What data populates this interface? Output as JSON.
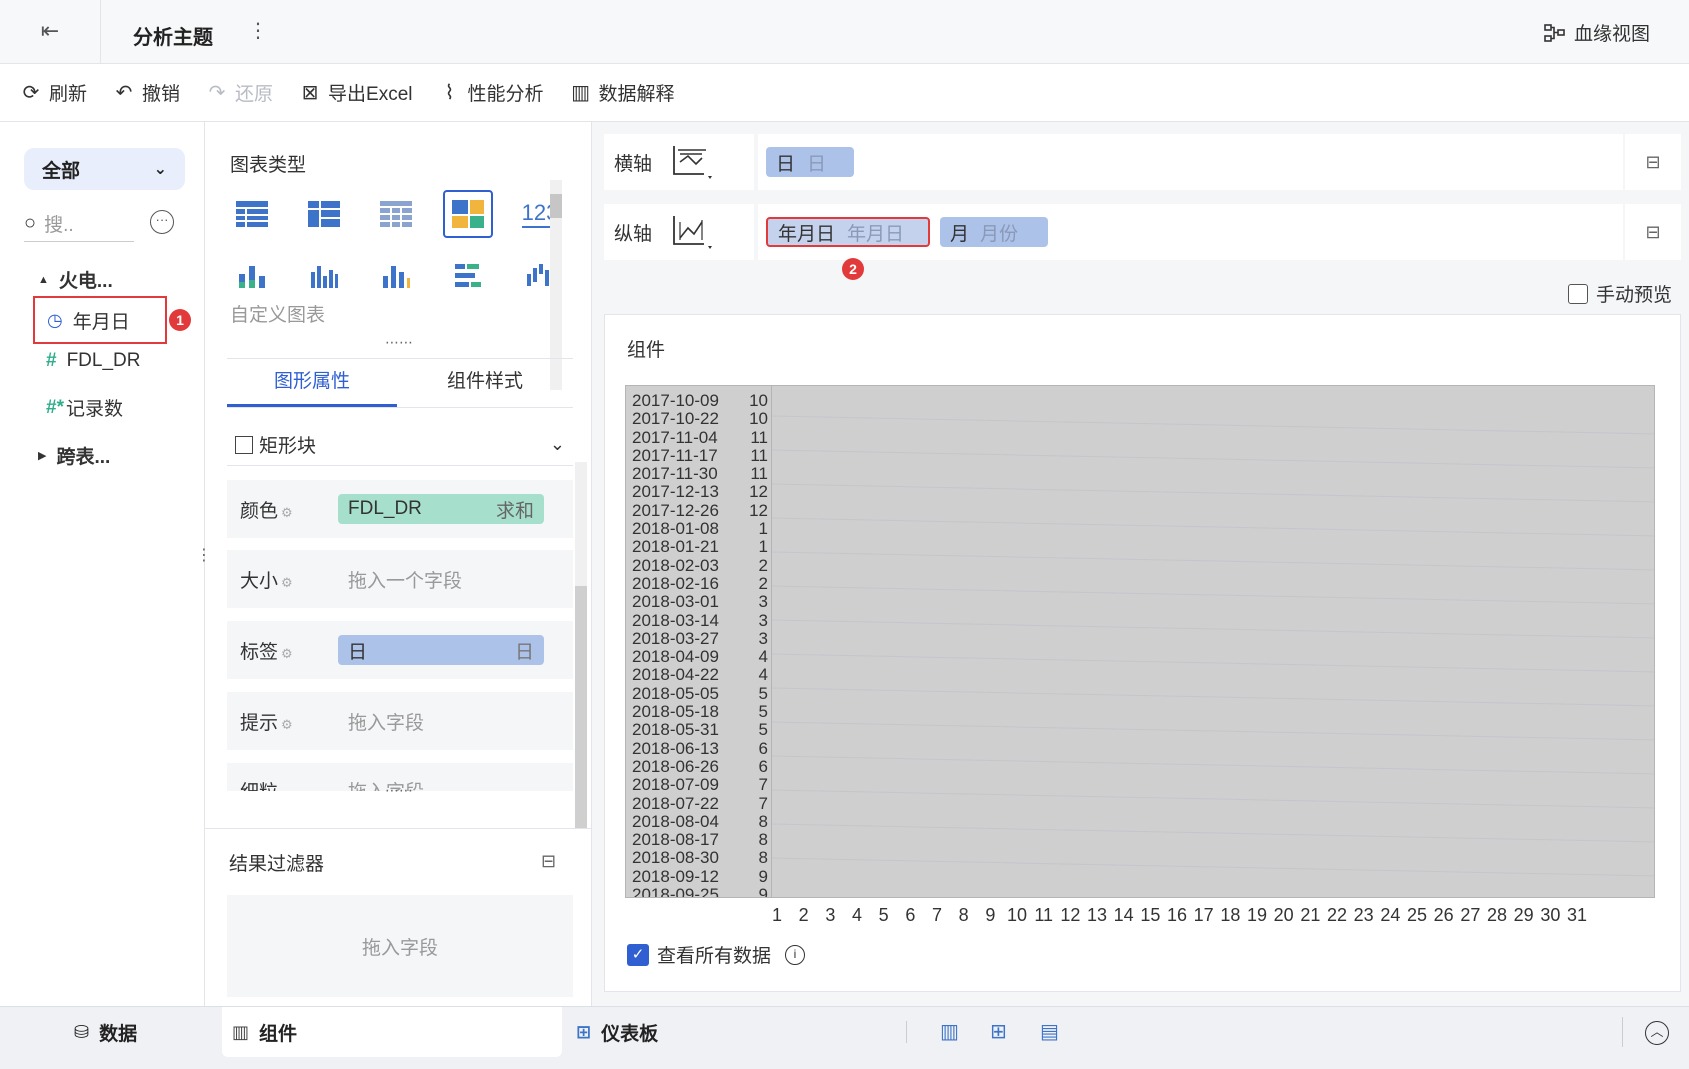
{
  "header": {
    "title": "分析主题",
    "lineage_label": "血缘视图"
  },
  "toolbar": {
    "refresh": "刷新",
    "undo": "撤销",
    "redo": "还原",
    "export": "导出Excel",
    "perf": "性能分析",
    "explain": "数据解释"
  },
  "data_panel": {
    "scope": "全部",
    "search_placeholder": "搜..",
    "group1": "火电...",
    "fields": [
      "年月日",
      "FDL_DR",
      "记录数"
    ],
    "group2": "跨表...",
    "badge1": "1"
  },
  "chart_panel": {
    "section_title": "图表类型",
    "custom_chart": "自定义图表",
    "chart_type_123": "123",
    "tab_graph_props": "图形属性",
    "tab_widget_style": "组件样式",
    "mark_type": "矩形块",
    "rows": {
      "color_label": "颜色",
      "color_field": "FDL_DR",
      "color_agg": "求和",
      "size_label": "大小",
      "size_hint": "拖入一个字段",
      "label_label": "标签",
      "label_field": "日",
      "label_sub": "日",
      "tooltip_label": "提示",
      "tooltip_hint": "拖入字段",
      "granularity_label": "细粒度",
      "granularity_hint": "拖入字段"
    },
    "filter_title": "结果过滤器",
    "filter_hint": "拖入字段"
  },
  "axes": {
    "x_label": "横轴",
    "x_field": "日",
    "x_field_sub": "日",
    "y_label": "纵轴",
    "y_field1": "年月日",
    "y_field1_sub": "年月日",
    "y_field2": "月",
    "y_field2_sub": "月份",
    "badge2": "2",
    "manual_preview": "手动预览"
  },
  "widget": {
    "title": "组件",
    "view_all": "查看所有数据"
  },
  "chart_data": {
    "type": "heatmap",
    "y_dates": [
      "2017-10-09",
      "2017-10-22",
      "2017-11-04",
      "2017-11-17",
      "2017-11-30",
      "2017-12-13",
      "2017-12-26",
      "2018-01-08",
      "2018-01-21",
      "2018-02-03",
      "2018-02-16",
      "2018-03-01",
      "2018-03-14",
      "2018-03-27",
      "2018-04-09",
      "2018-04-22",
      "2018-05-05",
      "2018-05-18",
      "2018-05-31",
      "2018-06-13",
      "2018-06-26",
      "2018-07-09",
      "2018-07-22",
      "2018-08-04",
      "2018-08-17",
      "2018-08-30",
      "2018-09-12",
      "2018-09-25"
    ],
    "y_months": [
      "10",
      "10",
      "11",
      "11",
      "11",
      "12",
      "12",
      "1",
      "1",
      "2",
      "2",
      "3",
      "3",
      "3",
      "4",
      "4",
      "5",
      "5",
      "5",
      "6",
      "6",
      "7",
      "7",
      "8",
      "8",
      "8",
      "9",
      "9"
    ],
    "x_categories": [
      "1",
      "2",
      "3",
      "4",
      "5",
      "6",
      "7",
      "8",
      "9",
      "10",
      "11",
      "12",
      "13",
      "14",
      "15",
      "16",
      "17",
      "18",
      "19",
      "20",
      "21",
      "22",
      "23",
      "24",
      "25",
      "26",
      "27",
      "28",
      "29",
      "30",
      "31"
    ]
  },
  "bottom": {
    "tab_data": "数据",
    "tab_widget": "组件",
    "tab_dashboard": "仪表板"
  }
}
